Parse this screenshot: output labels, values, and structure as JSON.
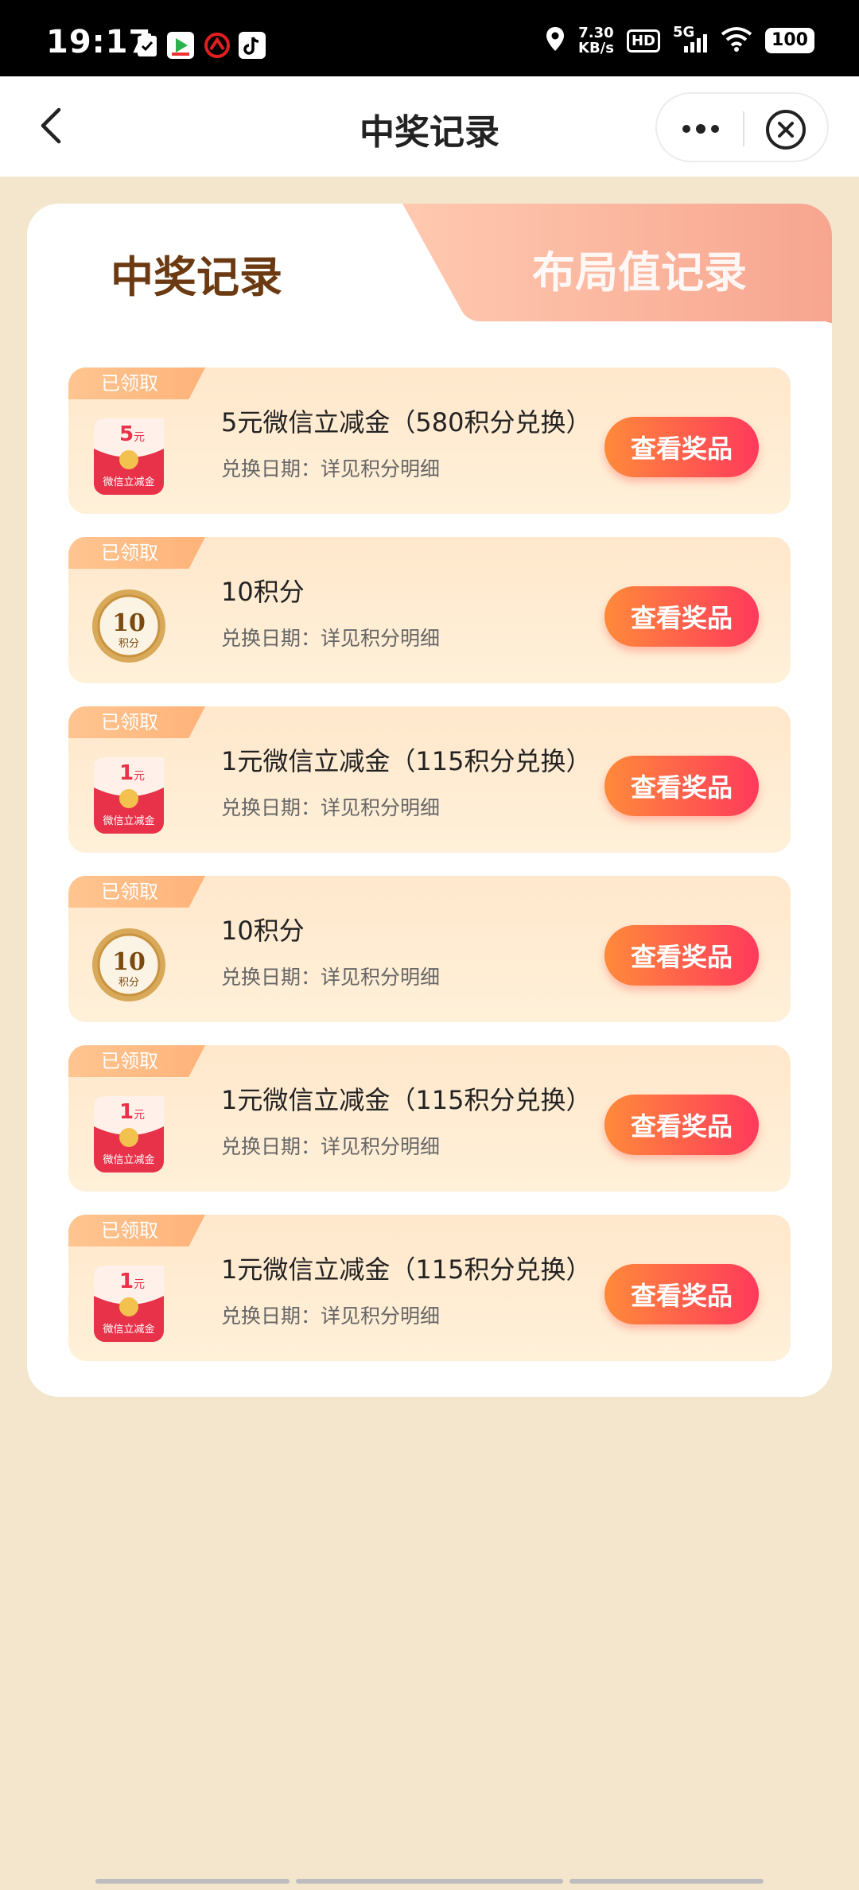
{
  "status_bar": {
    "time": "19:17",
    "net_speed_value": "7.30",
    "net_speed_unit": "KB/s",
    "hd": "HD",
    "network": "5G",
    "battery": "100"
  },
  "nav": {
    "title": "中奖记录",
    "back_icon": "chevron-left-icon",
    "more_icon": "more-dots-icon",
    "close_icon": "close-circle-icon"
  },
  "tabs": {
    "active": "中奖记录",
    "inactive": "布局值记录"
  },
  "records": [
    {
      "badge": "已领取",
      "title": "5元微信立减金（580积分兑换）",
      "subtitle": "兑换日期：详见积分明细",
      "button": "查看奖品",
      "icon": "red-envelope-icon",
      "amount": "5",
      "unit": "元",
      "caption": "微信立减金"
    },
    {
      "badge": "已领取",
      "title": "10积分",
      "subtitle": "兑换日期：详见积分明细",
      "button": "查看奖品",
      "icon": "points-coin-icon",
      "amount": "10",
      "unit": "积分"
    },
    {
      "badge": "已领取",
      "title": "1元微信立减金（115积分兑换）",
      "subtitle": "兑换日期：详见积分明细",
      "button": "查看奖品",
      "icon": "red-envelope-icon",
      "amount": "1",
      "unit": "元",
      "caption": "微信立减金"
    },
    {
      "badge": "已领取",
      "title": "10积分",
      "subtitle": "兑换日期：详见积分明细",
      "button": "查看奖品",
      "icon": "points-coin-icon",
      "amount": "10",
      "unit": "积分"
    },
    {
      "badge": "已领取",
      "title": "1元微信立减金（115积分兑换）",
      "subtitle": "兑换日期：详见积分明细",
      "button": "查看奖品",
      "icon": "red-envelope-icon",
      "amount": "1",
      "unit": "元",
      "caption": "微信立减金"
    },
    {
      "badge": "已领取",
      "title": "1元微信立减金（115积分兑换）",
      "subtitle": "兑换日期：详见积分明细",
      "button": "查看奖品",
      "icon": "red-envelope-icon",
      "amount": "1",
      "unit": "元",
      "caption": "微信立减金"
    }
  ],
  "colors": {
    "page_bg": "#f4e6cd",
    "title_brown": "#6b3a12",
    "button_start": "#ff8a3a",
    "button_end": "#ff3a5c",
    "tab_inactive": "#f7a58f"
  }
}
